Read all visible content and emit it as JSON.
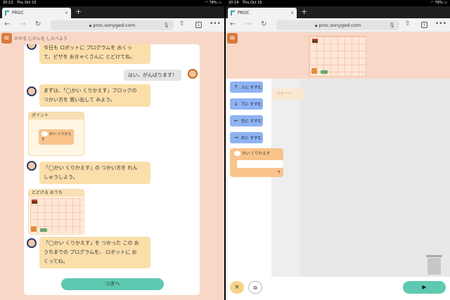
{
  "left": {
    "status": {
      "time": "20:13",
      "date": "Thu Oct 15",
      "battery": "78%"
    },
    "tab_title": "PROC",
    "url": "proc.sonyged.com",
    "tab_count": "1",
    "hint": "かかる じかんを しらべよう",
    "messages": {
      "m1a": "今日も ロボットに プログラムを おくっ",
      "m1b": "て、ピザを おきゃくさんに とどけてね。",
      "reply": "はい、がんばります！",
      "m2a": "まずは、「◯かい くりかえす」ブロックの",
      "m2b": "つかい方を 思い出して みよう。",
      "m3a": "「◯かい くりかえす」の つかい方を れん",
      "m3b": "しゅうしよう。",
      "m4a": "「◯かい くりかえす」を つかった この お",
      "m4b": "うちまでの プログラムを、 ロボットに お",
      "m4c": "くってね。"
    },
    "point_title": "ポイント",
    "point_block": "かい くりかえす",
    "house_title": "とどける おうち",
    "next_button": "つぎへ"
  },
  "right": {
    "status": {
      "time": "20:14",
      "date": "Thu Oct 15",
      "battery": "78%"
    },
    "tab_title": "PROC",
    "url": "proc.sonyged.com",
    "tab_count": "1",
    "blocks": {
      "up": "上に すすむ",
      "down": "下に すすむ",
      "left": "左に すすむ",
      "right": "右に すすむ",
      "loop": "かい くりかえす"
    },
    "start_label": "スタート",
    "close_icon": "×",
    "play_icon": "▶"
  }
}
